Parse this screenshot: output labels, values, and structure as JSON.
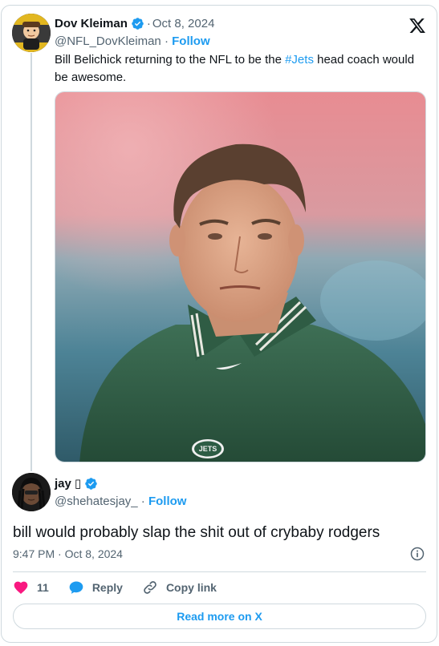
{
  "quoted_tweet": {
    "author_name": "Dov Kleiman",
    "date": "Oct 8, 2024",
    "handle": "@NFL_DovKleiman",
    "follow_label": "Follow",
    "text_before": "Bill Belichick returning to the NFL to be the ",
    "hashtag": "#Jets",
    "text_after": " head coach would be awesome.",
    "logo_text": "JETS"
  },
  "reply_tweet": {
    "author_name": "jay",
    "author_emoji": "▯",
    "handle": "@shehatesjay_",
    "follow_label": "Follow",
    "text": "bill would probably slap the shit out of crybaby rodgers",
    "timestamp": "9:47 PM · Oct 8, 2024"
  },
  "actions": {
    "like_count": "11",
    "reply_label": "Reply",
    "copy_label": "Copy link"
  },
  "footer": {
    "read_more_label": "Read more on X"
  },
  "colors": {
    "accent": "#1d9bf0",
    "like": "#f91880",
    "muted": "#536471",
    "border": "#cfd9de"
  },
  "icons": {
    "platform": "x-logo-icon",
    "verified": "verified-badge-icon",
    "info": "info-icon",
    "like": "heart-icon",
    "reply": "reply-bubble-icon",
    "copy": "link-icon"
  }
}
